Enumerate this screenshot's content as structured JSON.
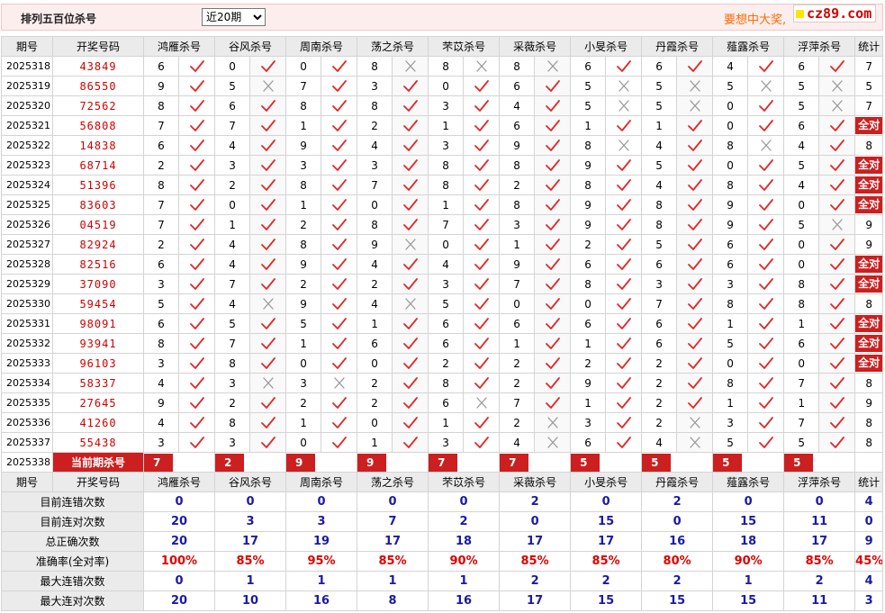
{
  "header": {
    "title": "排列五百位杀号",
    "period_options": [
      "近20期"
    ],
    "period_selected": "近20期",
    "promo": "要想中大奖,",
    "logo_text": "cz89.com"
  },
  "columns": [
    "期号",
    "开奖号码",
    "鸿雁杀号",
    "谷风杀号",
    "周南杀号",
    "荡之杀号",
    "芣苡杀号",
    "采薇杀号",
    "小旻杀号",
    "丹霞杀号",
    "薤露杀号",
    "浮萍杀号",
    "统计"
  ],
  "colors": {
    "accent": "#cc1f1f",
    "check": "#e02828",
    "cross": "#999999",
    "blue": "#1a1aa8",
    "header_bg": "#ebebeb"
  },
  "rows": [
    {
      "period": "2025318",
      "number": "43849",
      "kills": [
        [
          "6",
          "ok"
        ],
        [
          "0",
          "ok"
        ],
        [
          "0",
          "ok"
        ],
        [
          "8",
          "x"
        ],
        [
          "8",
          "x"
        ],
        [
          "8",
          "x"
        ],
        [
          "6",
          "ok"
        ],
        [
          "6",
          "ok"
        ],
        [
          "4",
          "ok"
        ],
        [
          "6",
          "ok"
        ]
      ],
      "stat": "7"
    },
    {
      "period": "2025319",
      "number": "86550",
      "kills": [
        [
          "9",
          "ok"
        ],
        [
          "5",
          "x"
        ],
        [
          "7",
          "ok"
        ],
        [
          "3",
          "ok"
        ],
        [
          "0",
          "ok"
        ],
        [
          "6",
          "ok"
        ],
        [
          "5",
          "x"
        ],
        [
          "5",
          "x"
        ],
        [
          "5",
          "x"
        ],
        [
          "5",
          "x"
        ]
      ],
      "stat": "5"
    },
    {
      "period": "2025320",
      "number": "72562",
      "kills": [
        [
          "8",
          "ok"
        ],
        [
          "6",
          "ok"
        ],
        [
          "8",
          "ok"
        ],
        [
          "8",
          "ok"
        ],
        [
          "3",
          "ok"
        ],
        [
          "4",
          "ok"
        ],
        [
          "5",
          "x"
        ],
        [
          "5",
          "x"
        ],
        [
          "0",
          "ok"
        ],
        [
          "5",
          "x"
        ]
      ],
      "stat": "7"
    },
    {
      "period": "2025321",
      "number": "56808",
      "kills": [
        [
          "7",
          "ok"
        ],
        [
          "7",
          "ok"
        ],
        [
          "1",
          "ok"
        ],
        [
          "2",
          "ok"
        ],
        [
          "1",
          "ok"
        ],
        [
          "6",
          "ok"
        ],
        [
          "1",
          "ok"
        ],
        [
          "1",
          "ok"
        ],
        [
          "0",
          "ok"
        ],
        [
          "6",
          "ok"
        ]
      ],
      "stat": "全对"
    },
    {
      "period": "2025322",
      "number": "14838",
      "kills": [
        [
          "6",
          "ok"
        ],
        [
          "4",
          "ok"
        ],
        [
          "9",
          "ok"
        ],
        [
          "4",
          "ok"
        ],
        [
          "3",
          "ok"
        ],
        [
          "9",
          "ok"
        ],
        [
          "8",
          "x"
        ],
        [
          "4",
          "ok"
        ],
        [
          "8",
          "x"
        ],
        [
          "4",
          "ok"
        ]
      ],
      "stat": "8"
    },
    {
      "period": "2025323",
      "number": "68714",
      "kills": [
        [
          "2",
          "ok"
        ],
        [
          "3",
          "ok"
        ],
        [
          "3",
          "ok"
        ],
        [
          "3",
          "ok"
        ],
        [
          "8",
          "ok"
        ],
        [
          "8",
          "ok"
        ],
        [
          "9",
          "ok"
        ],
        [
          "5",
          "ok"
        ],
        [
          "0",
          "ok"
        ],
        [
          "5",
          "ok"
        ]
      ],
      "stat": "全对"
    },
    {
      "period": "2025324",
      "number": "51396",
      "kills": [
        [
          "8",
          "ok"
        ],
        [
          "2",
          "ok"
        ],
        [
          "8",
          "ok"
        ],
        [
          "7",
          "ok"
        ],
        [
          "8",
          "ok"
        ],
        [
          "2",
          "ok"
        ],
        [
          "8",
          "ok"
        ],
        [
          "4",
          "ok"
        ],
        [
          "8",
          "ok"
        ],
        [
          "4",
          "ok"
        ]
      ],
      "stat": "全对"
    },
    {
      "period": "2025325",
      "number": "83603",
      "kills": [
        [
          "7",
          "ok"
        ],
        [
          "0",
          "ok"
        ],
        [
          "1",
          "ok"
        ],
        [
          "0",
          "ok"
        ],
        [
          "1",
          "ok"
        ],
        [
          "8",
          "ok"
        ],
        [
          "9",
          "ok"
        ],
        [
          "8",
          "ok"
        ],
        [
          "9",
          "ok"
        ],
        [
          "0",
          "ok"
        ]
      ],
      "stat": "全对"
    },
    {
      "period": "2025326",
      "number": "04519",
      "kills": [
        [
          "7",
          "ok"
        ],
        [
          "1",
          "ok"
        ],
        [
          "2",
          "ok"
        ],
        [
          "8",
          "ok"
        ],
        [
          "7",
          "ok"
        ],
        [
          "3",
          "ok"
        ],
        [
          "9",
          "ok"
        ],
        [
          "8",
          "ok"
        ],
        [
          "9",
          "ok"
        ],
        [
          "5",
          "x"
        ]
      ],
      "stat": "9"
    },
    {
      "period": "2025327",
      "number": "82924",
      "kills": [
        [
          "2",
          "ok"
        ],
        [
          "4",
          "ok"
        ],
        [
          "8",
          "ok"
        ],
        [
          "9",
          "x"
        ],
        [
          "0",
          "ok"
        ],
        [
          "1",
          "ok"
        ],
        [
          "2",
          "ok"
        ],
        [
          "5",
          "ok"
        ],
        [
          "6",
          "ok"
        ],
        [
          "0",
          "ok"
        ]
      ],
      "stat": "9"
    },
    {
      "period": "2025328",
      "number": "82516",
      "kills": [
        [
          "6",
          "ok"
        ],
        [
          "4",
          "ok"
        ],
        [
          "9",
          "ok"
        ],
        [
          "4",
          "ok"
        ],
        [
          "4",
          "ok"
        ],
        [
          "9",
          "ok"
        ],
        [
          "6",
          "ok"
        ],
        [
          "6",
          "ok"
        ],
        [
          "6",
          "ok"
        ],
        [
          "0",
          "ok"
        ]
      ],
      "stat": "全对"
    },
    {
      "period": "2025329",
      "number": "37090",
      "kills": [
        [
          "3",
          "ok"
        ],
        [
          "7",
          "ok"
        ],
        [
          "2",
          "ok"
        ],
        [
          "2",
          "ok"
        ],
        [
          "3",
          "ok"
        ],
        [
          "7",
          "ok"
        ],
        [
          "8",
          "ok"
        ],
        [
          "3",
          "ok"
        ],
        [
          "3",
          "ok"
        ],
        [
          "8",
          "ok"
        ]
      ],
      "stat": "全对"
    },
    {
      "period": "2025330",
      "number": "59454",
      "kills": [
        [
          "5",
          "ok"
        ],
        [
          "4",
          "x"
        ],
        [
          "9",
          "ok"
        ],
        [
          "4",
          "x"
        ],
        [
          "5",
          "ok"
        ],
        [
          "0",
          "ok"
        ],
        [
          "0",
          "ok"
        ],
        [
          "7",
          "ok"
        ],
        [
          "8",
          "ok"
        ],
        [
          "8",
          "ok"
        ]
      ],
      "stat": "8"
    },
    {
      "period": "2025331",
      "number": "98091",
      "kills": [
        [
          "6",
          "ok"
        ],
        [
          "5",
          "ok"
        ],
        [
          "5",
          "ok"
        ],
        [
          "1",
          "ok"
        ],
        [
          "6",
          "ok"
        ],
        [
          "6",
          "ok"
        ],
        [
          "6",
          "ok"
        ],
        [
          "6",
          "ok"
        ],
        [
          "1",
          "ok"
        ],
        [
          "1",
          "ok"
        ]
      ],
      "stat": "全对"
    },
    {
      "period": "2025332",
      "number": "93941",
      "kills": [
        [
          "8",
          "ok"
        ],
        [
          "7",
          "ok"
        ],
        [
          "1",
          "ok"
        ],
        [
          "6",
          "ok"
        ],
        [
          "6",
          "ok"
        ],
        [
          "1",
          "ok"
        ],
        [
          "1",
          "ok"
        ],
        [
          "6",
          "ok"
        ],
        [
          "5",
          "ok"
        ],
        [
          "6",
          "ok"
        ]
      ],
      "stat": "全对"
    },
    {
      "period": "2025333",
      "number": "96103",
      "kills": [
        [
          "3",
          "ok"
        ],
        [
          "8",
          "ok"
        ],
        [
          "0",
          "ok"
        ],
        [
          "0",
          "ok"
        ],
        [
          "2",
          "ok"
        ],
        [
          "2",
          "ok"
        ],
        [
          "2",
          "ok"
        ],
        [
          "2",
          "ok"
        ],
        [
          "0",
          "ok"
        ],
        [
          "0",
          "ok"
        ]
      ],
      "stat": "全对"
    },
    {
      "period": "2025334",
      "number": "58337",
      "kills": [
        [
          "4",
          "ok"
        ],
        [
          "3",
          "x"
        ],
        [
          "3",
          "x"
        ],
        [
          "2",
          "ok"
        ],
        [
          "8",
          "ok"
        ],
        [
          "2",
          "ok"
        ],
        [
          "9",
          "ok"
        ],
        [
          "2",
          "ok"
        ],
        [
          "8",
          "ok"
        ],
        [
          "7",
          "ok"
        ]
      ],
      "stat": "8"
    },
    {
      "period": "2025335",
      "number": "27645",
      "kills": [
        [
          "9",
          "ok"
        ],
        [
          "2",
          "ok"
        ],
        [
          "2",
          "ok"
        ],
        [
          "2",
          "ok"
        ],
        [
          "6",
          "x"
        ],
        [
          "7",
          "ok"
        ],
        [
          "1",
          "ok"
        ],
        [
          "2",
          "ok"
        ],
        [
          "1",
          "ok"
        ],
        [
          "1",
          "ok"
        ]
      ],
      "stat": "9"
    },
    {
      "period": "2025336",
      "number": "41260",
      "kills": [
        [
          "4",
          "ok"
        ],
        [
          "8",
          "ok"
        ],
        [
          "1",
          "ok"
        ],
        [
          "0",
          "ok"
        ],
        [
          "1",
          "ok"
        ],
        [
          "2",
          "x"
        ],
        [
          "3",
          "ok"
        ],
        [
          "2",
          "x"
        ],
        [
          "3",
          "ok"
        ],
        [
          "7",
          "ok"
        ]
      ],
      "stat": "8"
    },
    {
      "period": "2025337",
      "number": "55438",
      "kills": [
        [
          "3",
          "ok"
        ],
        [
          "3",
          "ok"
        ],
        [
          "0",
          "ok"
        ],
        [
          "1",
          "ok"
        ],
        [
          "3",
          "ok"
        ],
        [
          "4",
          "x"
        ],
        [
          "6",
          "ok"
        ],
        [
          "4",
          "x"
        ],
        [
          "5",
          "ok"
        ],
        [
          "5",
          "ok"
        ]
      ],
      "stat": "8"
    }
  ],
  "current": {
    "period": "2025338",
    "label": "当前期杀号",
    "values": [
      "7",
      "2",
      "9",
      "9",
      "7",
      "7",
      "5",
      "5",
      "5",
      "5"
    ]
  },
  "summary": [
    {
      "label": "目前连错次数",
      "values": [
        "0",
        "0",
        "0",
        "0",
        "0",
        "2",
        "0",
        "2",
        "0",
        "0"
      ],
      "stat": "4",
      "red": false
    },
    {
      "label": "目前连对次数",
      "values": [
        "20",
        "3",
        "3",
        "7",
        "2",
        "0",
        "15",
        "0",
        "15",
        "11"
      ],
      "stat": "0",
      "red": false
    },
    {
      "label": "总正确次数",
      "values": [
        "20",
        "17",
        "19",
        "17",
        "18",
        "17",
        "17",
        "16",
        "18",
        "17"
      ],
      "stat": "9",
      "red": false
    },
    {
      "label": "准确率(全对率)",
      "values": [
        "100%",
        "85%",
        "95%",
        "85%",
        "90%",
        "85%",
        "85%",
        "80%",
        "90%",
        "85%"
      ],
      "stat": "45%",
      "red": true
    },
    {
      "label": "最大连错次数",
      "values": [
        "0",
        "1",
        "1",
        "1",
        "1",
        "2",
        "2",
        "2",
        "1",
        "2"
      ],
      "stat": "4",
      "red": false
    },
    {
      "label": "最大连对次数",
      "values": [
        "20",
        "10",
        "16",
        "8",
        "16",
        "17",
        "15",
        "15",
        "15",
        "11"
      ],
      "stat": "3",
      "red": false
    }
  ]
}
